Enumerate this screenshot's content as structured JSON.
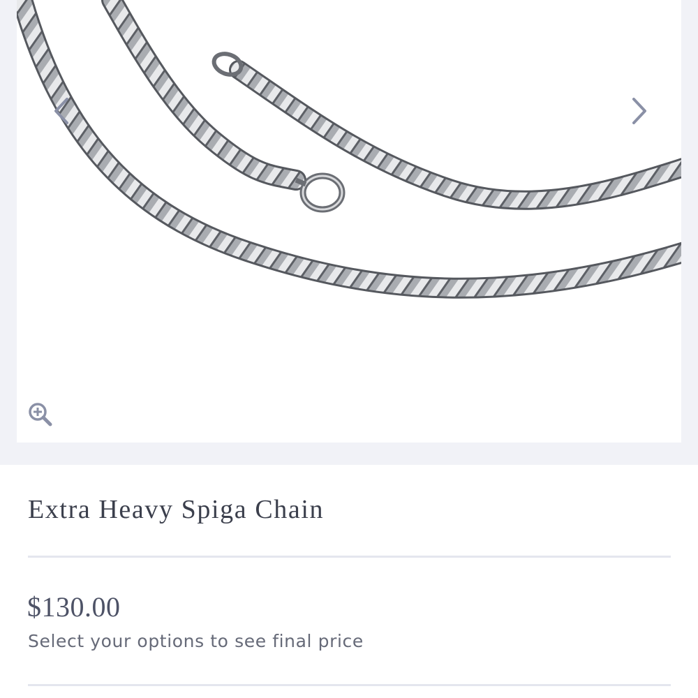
{
  "gallery": {
    "image_alt": "Extra Heavy Spiga Chain",
    "prev_icon": "chevron-left-icon",
    "next_icon": "chevron-right-icon",
    "zoom_icon": "zoom-in-icon"
  },
  "product": {
    "title": "Extra Heavy Spiga Chain",
    "price": "$130.00",
    "price_note": "Select your options to see final price"
  },
  "colors": {
    "background": "#f1f2f7",
    "arrow": "#8a90a6",
    "text": "#3b3f4c"
  }
}
